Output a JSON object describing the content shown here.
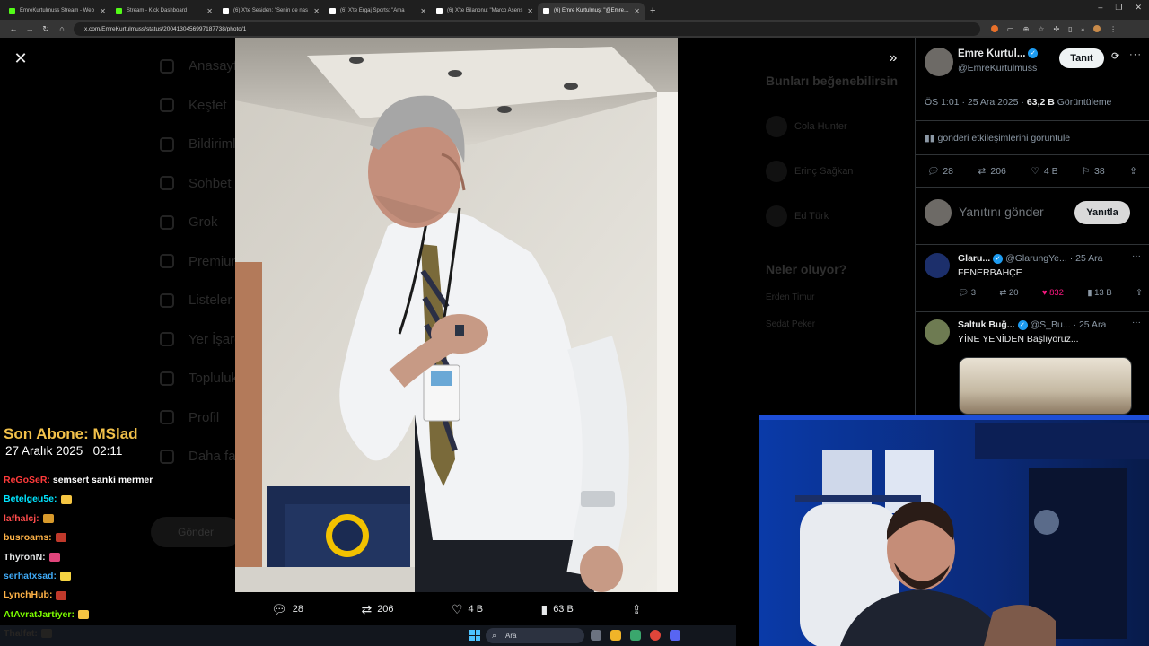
{
  "browser": {
    "tabs": [
      {
        "title": "EmreKurtulmuss Stream - Web",
        "favicon_color": "#53fc18",
        "active": false
      },
      {
        "title": "Stream - Kick Dashboard",
        "favicon_color": "#53fc18",
        "active": false
      },
      {
        "title": "(6) X'te Sesiden: \"Senin de nas",
        "favicon_color": "#ffffff",
        "active": false
      },
      {
        "title": "(6) X'te Ergaj Sports: \"Ama",
        "favicon_color": "#ffffff",
        "active": false
      },
      {
        "title": "(6) X'te Bilanonu: \"Marco Asens",
        "favicon_color": "#ffffff",
        "active": false
      },
      {
        "title": "(6) Emre Kurtulmuş: \"@Emreflei",
        "favicon_color": "#ffffff",
        "active": true
      }
    ],
    "new_tab_glyph": "+",
    "url": "x.com/EmreKurtulmuss/status/2004130456997187738/photo/1",
    "window_controls": [
      "–",
      "❐",
      "✕"
    ]
  },
  "background_page": {
    "nav_items": [
      "Anasayfa",
      "Keşfet",
      "Bildirimler",
      "Sohbet",
      "Grok",
      "Premium",
      "Listeler",
      "Yer İşaretleri",
      "Topluluklar",
      "Profil",
      "Daha fazla"
    ],
    "post_button": "Gönder",
    "right": {
      "heading1": "Bunları beğenebilirsin",
      "suggestions": [
        "Cola Hunter",
        "Erinç Sağkan",
        "Ed Türk"
      ],
      "heading2": "Neler oluyor?",
      "trends": [
        "Erden Timur",
        "Sedat Peker"
      ]
    }
  },
  "viewer": {
    "actions": {
      "replies": "28",
      "reposts": "206",
      "likes": "4 B",
      "views": "63 B"
    }
  },
  "tweet": {
    "display_name": "Emre Kurtul...",
    "handle": "@EmreKurtulmuss",
    "follow_label": "Tanıt",
    "time": "ÖS 1:01 · 25 Ara 2025",
    "views_count": "63,2 B",
    "views_label": "Görüntüleme",
    "engagements_link": "gönderi etkileşimlerini görüntüle",
    "stats": {
      "replies": "28",
      "reposts": "206",
      "likes": "4 B",
      "bookmarks": "38"
    },
    "reply_placeholder": "Yanıtını gönder",
    "reply_button": "Yanıtla"
  },
  "replies": [
    {
      "name": "Glaru...",
      "handle": "@GlarungYe...",
      "date": "· 25 Ara",
      "text": "FENERBAHÇE",
      "replies": "3",
      "reposts": "20",
      "likes": "832",
      "views": "13 B",
      "avatar_color": "#1c2f6b"
    },
    {
      "name": "Saltuk Buğ...",
      "handle": "@S_Bu...",
      "date": "· 25 Ara",
      "text": "YİNE YENİDEN Başlıyoruz...",
      "avatar_color": "#6e7b52"
    }
  ],
  "chat": {
    "last_sub": "Son Abone: MSlad",
    "date": "27 Aralık 2025",
    "time": "02:11",
    "lines": [
      {
        "user": "ReGoSeR:",
        "color": "#ff3b3b",
        "message": "semsert sanki mermer",
        "emote": ""
      },
      {
        "user": "Betelgeu5e:",
        "color": "#00e5ff",
        "message": "",
        "emote": "#f5c542"
      },
      {
        "user": "lafhalcj:",
        "color": "#ff4c4c",
        "message": "",
        "emote": "#d89a2b"
      },
      {
        "user": "busroams:",
        "color": "#ffb347",
        "message": "",
        "emote": "#c0392b"
      },
      {
        "user": "ThyronN:",
        "color": "#e7e9ea",
        "message": "",
        "emote": "#e0457b"
      },
      {
        "user": "serhatxsad:",
        "color": "#3fa9f5",
        "message": "",
        "emote": "#f5d442"
      },
      {
        "user": "LynchHub:",
        "color": "#ffb347",
        "message": "",
        "emote": "#c0392b"
      },
      {
        "user": "AtAvratJartiyer:",
        "color": "#7CFC00",
        "message": "",
        "emote": "#f5c542"
      },
      {
        "user": "Thalfat:",
        "color": "#ffb347",
        "message": "",
        "emote": "#d89a2b"
      }
    ]
  },
  "taskbar": {
    "search_placeholder": "Ara"
  },
  "colors": {
    "accent": "#1d9bf0",
    "like": "#f91880",
    "gold": "#f2c14a"
  }
}
